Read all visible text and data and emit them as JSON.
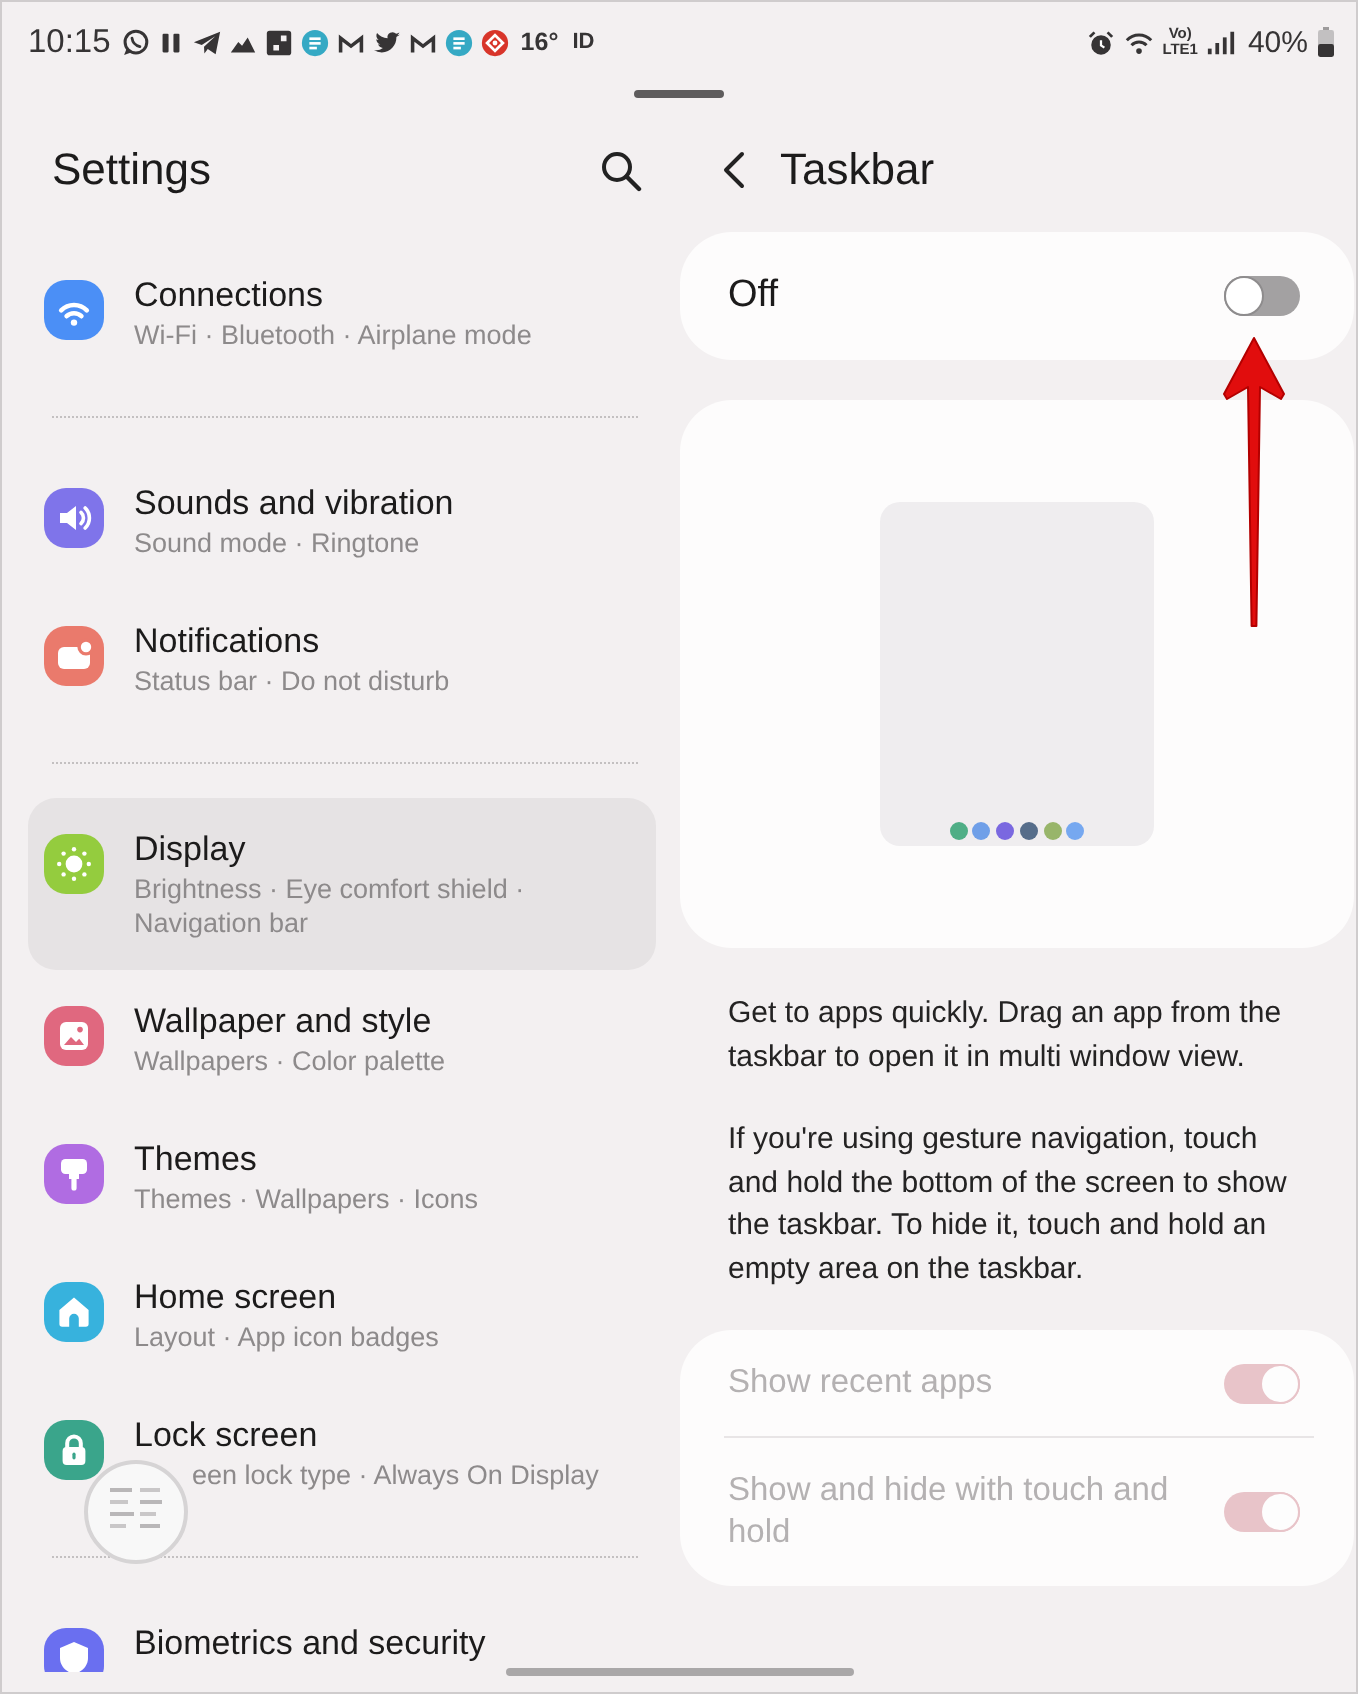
{
  "status_bar": {
    "time": "10:15",
    "temperature": "16°",
    "indicator": "ID",
    "network_top": "Vo)",
    "network_bottom": "LTE1",
    "battery": "40%"
  },
  "settings": {
    "title": "Settings",
    "groups": [
      [
        {
          "title": "Connections",
          "subtitle": "Wi-Fi · Bluetooth · Airplane mode",
          "selected": false,
          "kind": "entry"
        }
      ],
      [
        {
          "title": "Sounds and vibration",
          "subtitle": "Sound mode · Ringtone",
          "selected": false,
          "kind": "entry"
        },
        {
          "title": "Notifications",
          "subtitle": "Status bar · Do not disturb",
          "selected": false,
          "kind": "entry"
        }
      ],
      [
        {
          "title": "Display",
          "subtitle": "Brightness · Eye comfort shield · Navigation bar",
          "selected": true,
          "kind": "entry"
        },
        {
          "title": "Wallpaper and style",
          "subtitle": "Wallpapers · Color palette",
          "selected": false,
          "kind": "entry"
        },
        {
          "title": "Themes",
          "subtitle": "Themes · Wallpapers · Icons",
          "selected": false,
          "kind": "entry"
        },
        {
          "title": "Home screen",
          "subtitle": "Layout · App icon badges",
          "selected": false,
          "kind": "entry"
        },
        {
          "title": "Lock screen",
          "subtitle": "een lock type · Always On Display",
          "selected": false,
          "kind": "entry-under-bubble"
        }
      ],
      [
        {
          "title": "Biometrics and security",
          "selected": false,
          "kind": "entry"
        }
      ]
    ]
  },
  "taskbar": {
    "title": "Taskbar",
    "master_switch": {
      "label": "Off",
      "on": false
    },
    "preview": {
      "taskbar_icons": [
        {
          "color": "#4fae86"
        },
        {
          "color": "#6f9fe8"
        },
        {
          "color": "#7a68e0"
        },
        {
          "color": "#566d8a"
        },
        {
          "color": "#98b56a"
        },
        {
          "color": "#76a8f0"
        }
      ]
    },
    "description": [
      "Get to apps quickly. Drag an app from the taskbar to open it in multi window view.",
      "If you're using gesture navigation, touch and hold the bottom of the screen to show the taskbar. To hide it, touch and hold an empty area on the taskbar."
    ],
    "options": [
      {
        "label": "Show recent apps",
        "on": true,
        "disabled": true
      },
      {
        "label": "Show and hide with touch and hold",
        "on": true,
        "disabled": true
      }
    ]
  }
}
